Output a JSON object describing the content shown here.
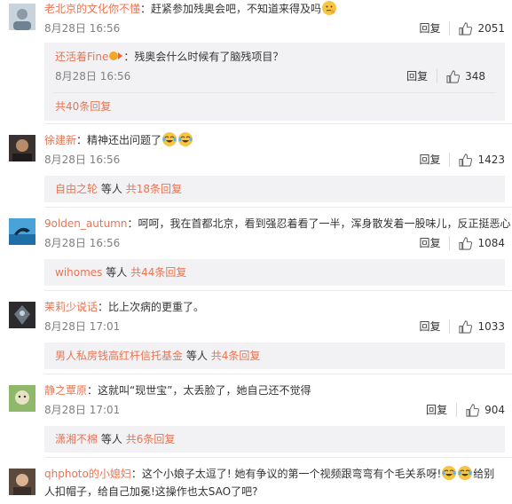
{
  "reply_label": "回复",
  "more_suffix_label": "等人",
  "comments": [
    {
      "user": "老北京的文化你不懂",
      "text": "：赶紧参加残奥会吧，不知道来得及吗",
      "time": "8月28日 16:56",
      "likes": "2051",
      "sub": {
        "user": "还活着Fine",
        "text": "：残奥会什么时候有了脑残项目？",
        "time": "8月28日 16:56",
        "likes": "348",
        "more": "共40条回复"
      }
    },
    {
      "user": "徐建新",
      "text": "：精神还出问题了",
      "time": "8月28日 16:56",
      "likes": "1423",
      "more_user": "自由之轮",
      "more_count": "共18条回复"
    },
    {
      "user": "9olden_autumn",
      "text": "：呵呵，我在首都北京，看到强忍着看了一半，浑身散发着一股味儿，反正挺恶心",
      "time": "8月28日 16:56",
      "likes": "1084",
      "more_user": "wihomes",
      "more_count": "共44条回复"
    },
    {
      "user": "茉莉少说话",
      "text": "：比上次病的更重了。",
      "time": "8月28日 17:01",
      "likes": "1033",
      "more_user": "男人私房钱高红杆信托基金",
      "more_count": "共4条回复"
    },
    {
      "user": "静之覃原",
      "text": "：这就叫“现世宝”，太丢脸了，她自己还不觉得",
      "time": "8月28日 17:01",
      "likes": "904",
      "more_user": "潇湘不棉",
      "more_count": "共6条回复"
    },
    {
      "user": "qhphoto的小媳妇",
      "text": "：这个小娘子太逗了! 她有争议的第一个视频跟弯弯有个毛关系呀!",
      "text2": "给别人扣帽子，给自己加冕!这操作也太SAO了吧?"
    }
  ]
}
